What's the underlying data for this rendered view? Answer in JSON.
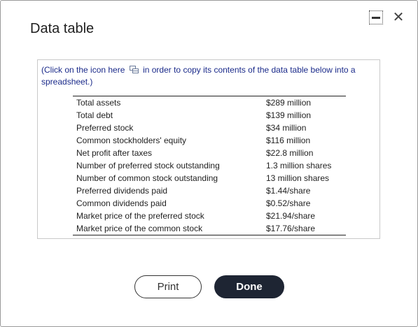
{
  "dialog": {
    "title": "Data table",
    "minimize_icon": "minimize-icon",
    "close_glyph": "✕"
  },
  "hint": {
    "before": "(Click on the icon here",
    "after": "in order to copy its contents of the data table below into a spreadsheet.)",
    "icon": "copy-spreadsheet-icon"
  },
  "table": {
    "rows": [
      {
        "label": "Total assets",
        "value": "$289 million"
      },
      {
        "label": "Total debt",
        "value": "$139 million"
      },
      {
        "label": "Preferred stock",
        "value": "$34 million"
      },
      {
        "label": "Common stockholders' equity",
        "value": "$116 million"
      },
      {
        "label": "Net profit after taxes",
        "value": "$22.8 million"
      },
      {
        "label": "Number of preferred stock outstanding",
        "value": "1.3 million shares"
      },
      {
        "label": "Number of common stock outstanding",
        "value": "13 million shares"
      },
      {
        "label": "Preferred dividends paid",
        "value": "$1.44/share"
      },
      {
        "label": "Common dividends paid",
        "value": "$0.52/share"
      },
      {
        "label": "Market price of the preferred stock",
        "value": "$21.94/share"
      },
      {
        "label": "Market price of the common stock",
        "value": "$17.76/share"
      }
    ]
  },
  "buttons": {
    "print": "Print",
    "done": "Done"
  },
  "colors": {
    "hint_text": "#1a2a8a",
    "done_bg": "#1e2533"
  }
}
